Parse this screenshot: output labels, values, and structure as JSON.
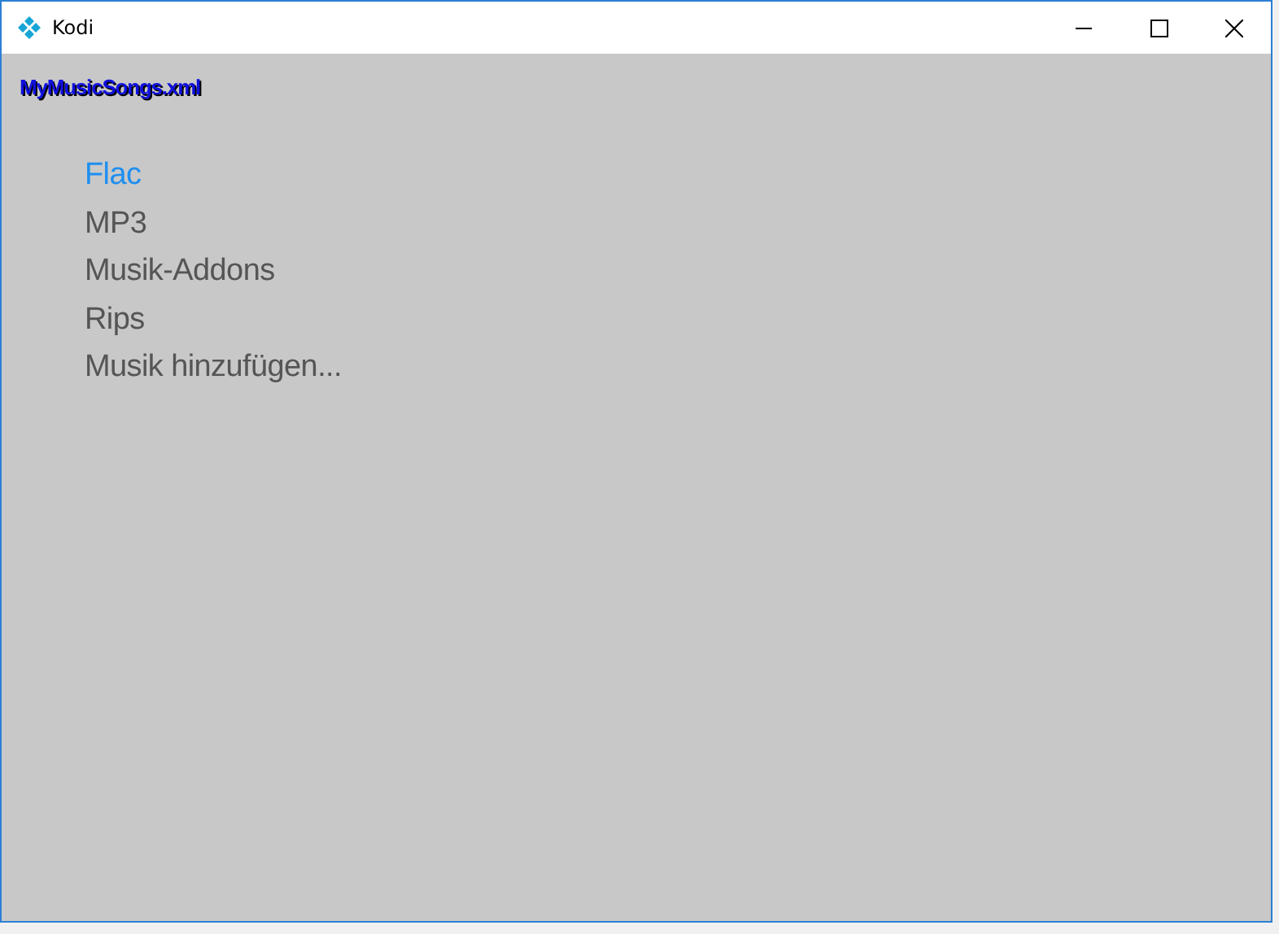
{
  "window": {
    "title": "Kodi"
  },
  "header": "MyMusicSongs.xml",
  "items": [
    {
      "label": "Flac",
      "selected": true
    },
    {
      "label": "MP3",
      "selected": false
    },
    {
      "label": "Musik-Addons",
      "selected": false
    },
    {
      "label": "Rips",
      "selected": false
    },
    {
      "label": "Musik hinzufügen...",
      "selected": false
    }
  ]
}
